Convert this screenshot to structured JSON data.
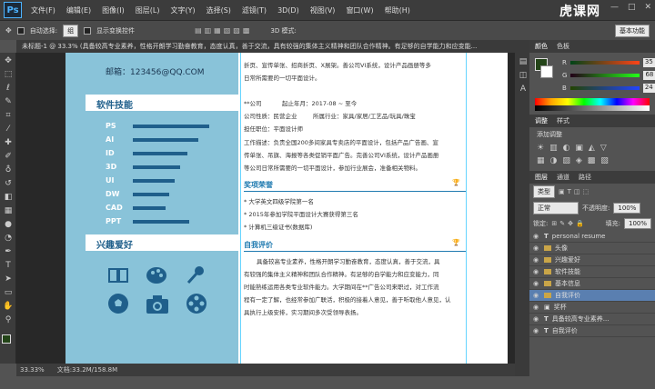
{
  "app": {
    "logo": "Ps",
    "watermark": "虎课网"
  },
  "menu": [
    "文件(F)",
    "编辑(E)",
    "图像(I)",
    "图层(L)",
    "文字(Y)",
    "选择(S)",
    "滤镜(T)",
    "3D(D)",
    "视图(V)",
    "窗口(W)",
    "帮助(H)"
  ],
  "window_controls": [
    "—",
    "□",
    "✕"
  ],
  "options": {
    "auto_select_label": "自动选择:",
    "auto_select_value": "组",
    "show_transform": "显示变换控件",
    "mode_3d": "3D 模式:",
    "workspace": "基本功能"
  },
  "doc_tab": "未标题-1 @ 33.3% (具备较高专业素养，性格开朗学习勤奋教育，态度认真，善于交流，具有较强的集体主义精神和团队合作精神。有足够的自学能力和应变能...",
  "resume": {
    "email": "邮箱：123456@QQ.COM",
    "skills_title": "软件技能",
    "skills": [
      {
        "name": "PS",
        "level": 0.84
      },
      {
        "name": "AI",
        "level": 0.72
      },
      {
        "name": "ID",
        "level": 0.6
      },
      {
        "name": "3D",
        "level": 0.52
      },
      {
        "name": "UI",
        "level": 0.46
      },
      {
        "name": "DW",
        "level": 0.4
      },
      {
        "name": "CAD",
        "level": 0.36
      },
      {
        "name": "PPT",
        "level": 0.62
      }
    ],
    "hobbies_title": "兴趣爱好",
    "right_top": [
      "折页、宣传单张、招商折页、X展架。善公司VI系统，设计产品画册等多",
      "日常所需要的一切平面设计。"
    ],
    "job": {
      "company": "**公司",
      "period": "起止年月：2017-08 ~ 至今",
      "nature": "公司性质：民营企业",
      "industry": "所属行业：家具/家居/工艺品/玩具/珠宝",
      "position": "担任职位：平面设计师",
      "desc": [
        "工作描述：负责全国200多间家具专卖店的平面设计，包括产品广告画、宣",
        "传单张、吊旗、海报等各类促销平面广告。完善公司VI系统，设计产品画册",
        "等公司日常所需要的一切平面设计，参加行业展会，准备相关物料。"
      ]
    },
    "awards_title": "奖项荣誉",
    "awards": [
      "* 大学英文四级学院第一名",
      "* 2015年参加学院平面设计大赛获得第三名",
      "* 计算机三级证书(数据库)"
    ],
    "self_title": "自我评价",
    "self_eval": [
      "具备较高专业素养，性格开朗学习勤奋教育，态度认真，善于交流，具",
      "有较强的集体主义精神和团队合作精神。有足够的自学能力和应变能力，同",
      "时能熟练运用各类专业软件能力。大学期间在**广告公司来职过，对工作流",
      "程有一定了解，也经常参加广联活，积极的接着人意见，善于听取他人意见，认",
      "具执行上级安排，实习期间多次受领导表扬。"
    ]
  },
  "status": {
    "zoom": "33.33%",
    "doc": "文档:33.2M/158.8M"
  },
  "color_panel": {
    "tabs": [
      "颜色",
      "色板"
    ],
    "r": "35",
    "g": "68",
    "b": "24",
    "r_label": "R",
    "g_label": "G",
    "b_label": "B"
  },
  "adjust_panel": {
    "tabs": [
      "调整",
      "样式"
    ],
    "add": "添加调整"
  },
  "layers_panel": {
    "tabs": [
      "图层",
      "通道",
      "路径"
    ],
    "kind": "类型",
    "blend": "正常",
    "opacity_label": "不透明度:",
    "opacity": "100%",
    "lock_label": "锁定:",
    "fill_label": "填充:",
    "fill": "100%",
    "layers": [
      {
        "name": "personal resume",
        "type": "text"
      },
      {
        "name": "头像",
        "type": "folder"
      },
      {
        "name": "兴趣爱好",
        "type": "folder"
      },
      {
        "name": "软件技能",
        "type": "folder"
      },
      {
        "name": "基本信息",
        "type": "folder"
      },
      {
        "name": "自我评价",
        "type": "folder",
        "selected": true
      },
      {
        "name": "奖杯",
        "type": "image"
      },
      {
        "name": "具备较高专业素养...",
        "type": "text"
      },
      {
        "name": "自我评价",
        "type": "text"
      }
    ]
  },
  "colors": {
    "left_column": "#89c3d9",
    "heading": "#1f7ab0",
    "bar": "#1f5f8b",
    "fg_swatch": "#234418"
  }
}
